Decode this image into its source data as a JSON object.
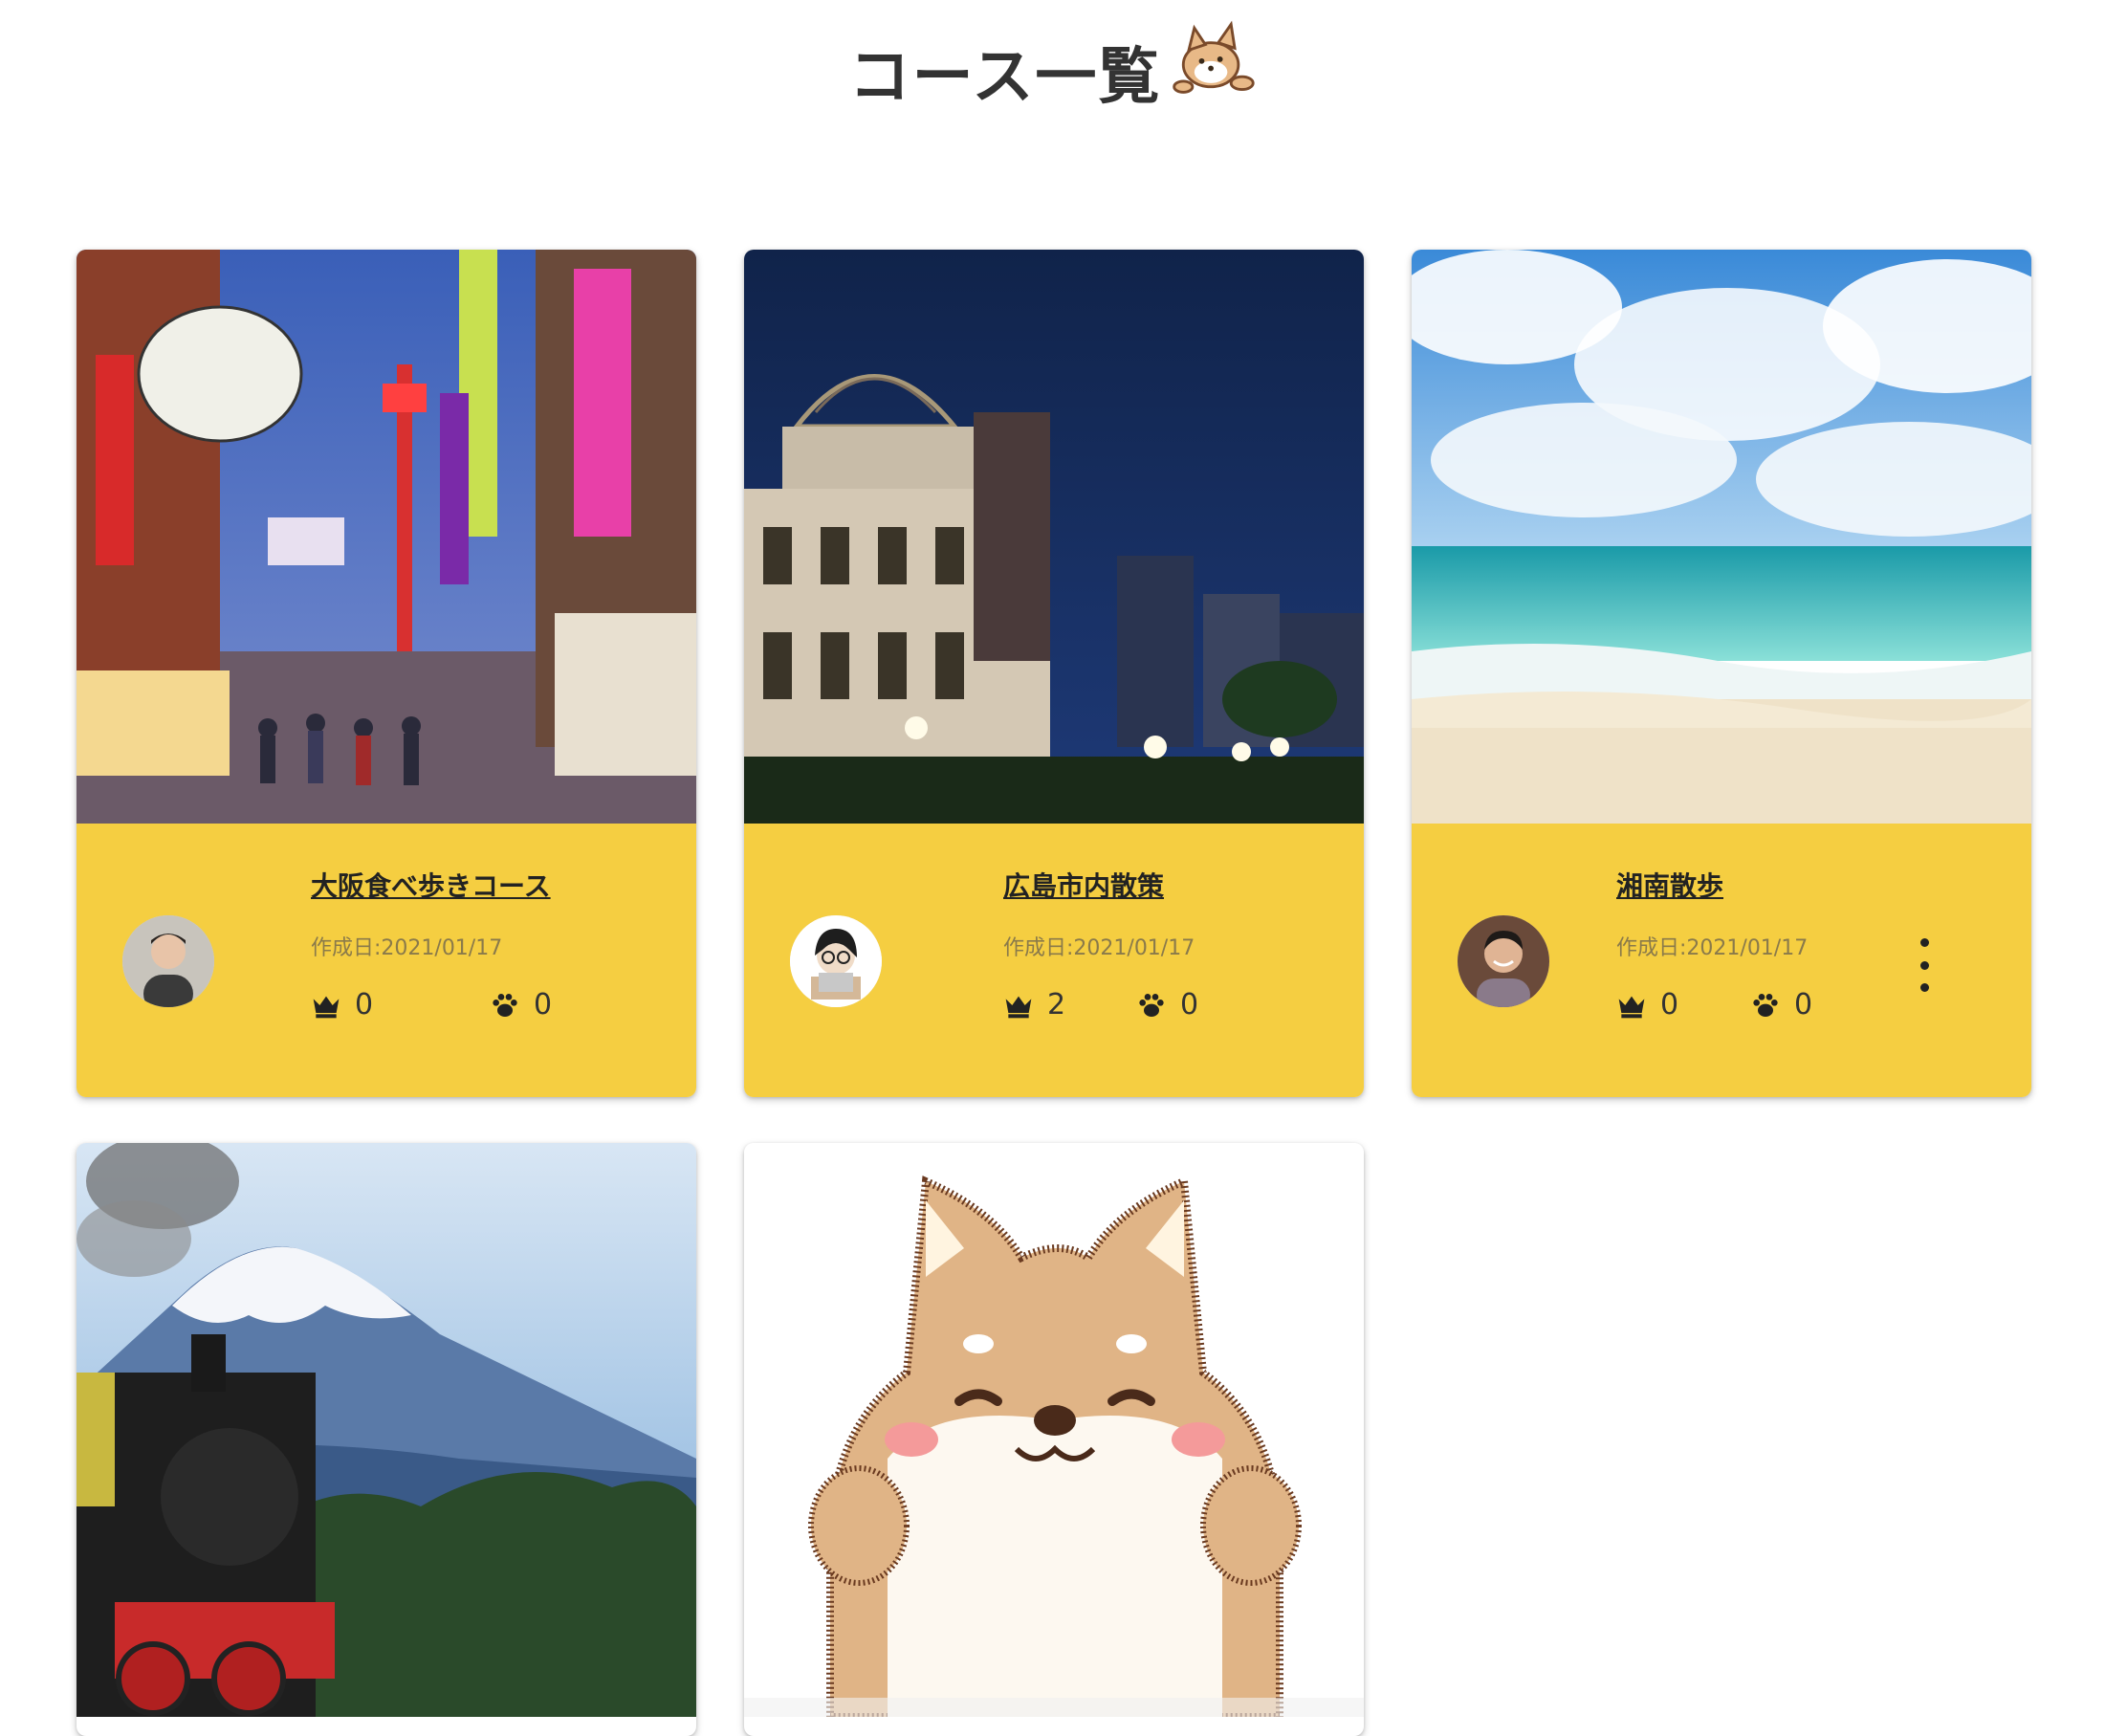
{
  "page": {
    "title": "コース一覧",
    "mascot_icon": "shiba-dog-icon"
  },
  "colors": {
    "card_footer": "#F5CE41",
    "text": "#333333"
  },
  "cards": [
    {
      "title": "大阪食べ歩きコース",
      "created": "作成日:2021/01/17",
      "crowns": "0",
      "paws": "0",
      "image": "osaka-shinsekai-photo",
      "avatar": "user-avatar-1"
    },
    {
      "title": "広島市内散策",
      "created": "作成日:2021/01/17",
      "crowns": "2",
      "paws": "0",
      "image": "hiroshima-dome-photo",
      "avatar": "user-avatar-2"
    },
    {
      "title": "湘南散歩",
      "created": "作成日:2021/01/17",
      "crowns": "0",
      "paws": "0",
      "image": "shonan-beach-photo",
      "avatar": "user-avatar-3",
      "has_menu": true
    },
    {
      "image": "fuji-steam-train-photo"
    },
    {
      "image": "shiba-dog-illustration"
    }
  ]
}
